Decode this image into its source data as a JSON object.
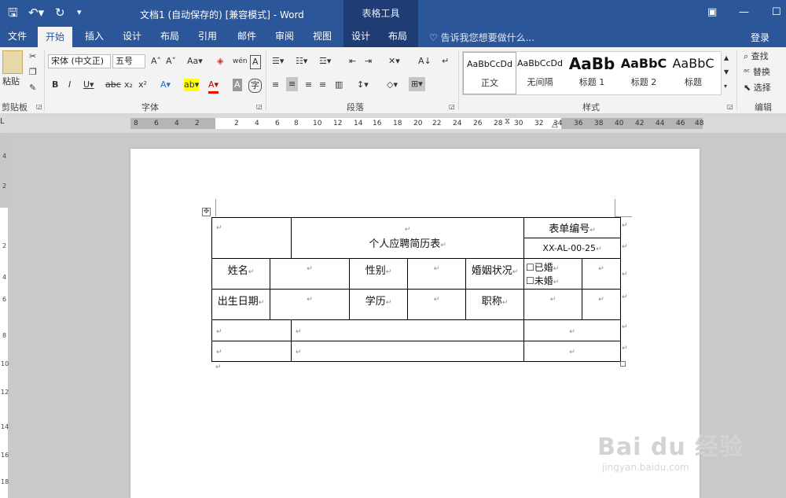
{
  "titlebar": {
    "document_title": "文档1 (自动保存的) [兼容模式] - Word",
    "context_tab_title": "表格工具",
    "save_icon": "save-icon",
    "undo_icon": "undo-icon",
    "redo_icon": "redo-icon"
  },
  "tabs": [
    "文件",
    "开始",
    "插入",
    "设计",
    "布局",
    "引用",
    "邮件",
    "审阅",
    "视图",
    "设计",
    "布局"
  ],
  "active_tab": "开始",
  "tell_me": "告诉我您想要做什么...",
  "login": "登录",
  "ribbon": {
    "clipboard": {
      "label": "剪贴板",
      "paste": "粘贴"
    },
    "font": {
      "label": "字体",
      "font_name": "宋体 (中文正)",
      "font_size": "五号"
    },
    "paragraph": {
      "label": "段落"
    },
    "styles": {
      "label": "样式",
      "items": [
        {
          "sample": "AaBbCcDd",
          "name": "正文"
        },
        {
          "sample": "AaBbCcDd",
          "name": "无间隔"
        },
        {
          "sample": "AaBb",
          "name": "标题 1"
        },
        {
          "sample": "AaBbC",
          "name": "标题 2"
        },
        {
          "sample": "AaBbC",
          "name": "标题"
        }
      ]
    },
    "editing": {
      "label": "编辑",
      "find": "查找",
      "replace": "替换",
      "select": "选择"
    }
  },
  "ruler_numbers": [
    "8",
    "6",
    "4",
    "2",
    "2",
    "4",
    "6",
    "8",
    "10",
    "12",
    "14",
    "16",
    "18",
    "20",
    "22",
    "24",
    "26",
    "28",
    "30",
    "32",
    "34",
    "36",
    "38",
    "40",
    "42",
    "44",
    "46",
    "48"
  ],
  "vruler_numbers": [
    "4",
    "2",
    "2",
    "4",
    "6",
    "8",
    "10",
    "12",
    "14",
    "16",
    "18"
  ],
  "form": {
    "title": "个人应聘简历表",
    "form_number_label": "表单编号",
    "form_number_value": "XX-AL-00-25",
    "name_label": "姓名",
    "gender_label": "性别",
    "marital_label": "婚姻状况",
    "married_option": "☐已婚",
    "single_option": "☐未婚",
    "birth_label": "出生日期",
    "education_label": "学历",
    "title_label": "职称"
  },
  "watermark": {
    "brand": "Bai du 经验",
    "url": "jingyan.baidu.com"
  }
}
